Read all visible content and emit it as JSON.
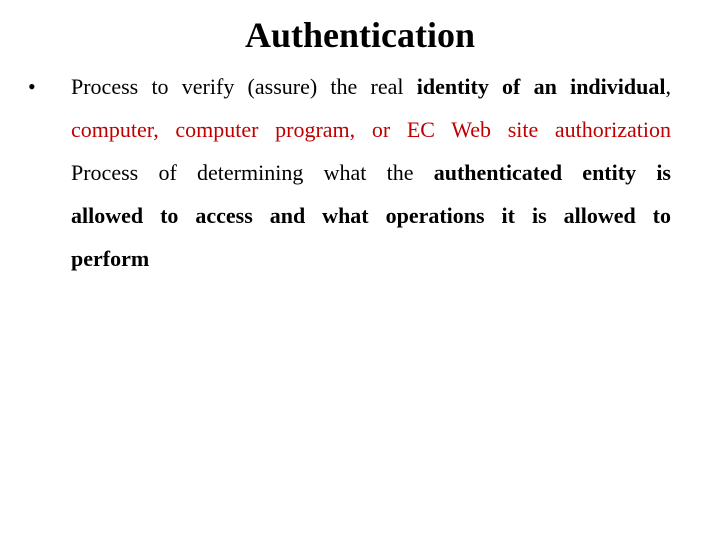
{
  "slide": {
    "title": "Authentication",
    "bullet_glyph": "•",
    "lines": [
      {
        "plain": "Process to verify (assure) the real ",
        "bold": "identity of an individual",
        "tail": ","
      },
      {
        "plain": "computer, computer program, or EC Web site authorization"
      },
      {
        "plain": "Process of determining what the ",
        "bold": "authenticated entity is"
      },
      {
        "bold": "allowed to access and what operations it is allowed to"
      },
      {
        "bold": "perform"
      }
    ],
    "colors": {
      "text": "#000000",
      "highlight": "#c00000",
      "background": "#ffffff"
    }
  }
}
